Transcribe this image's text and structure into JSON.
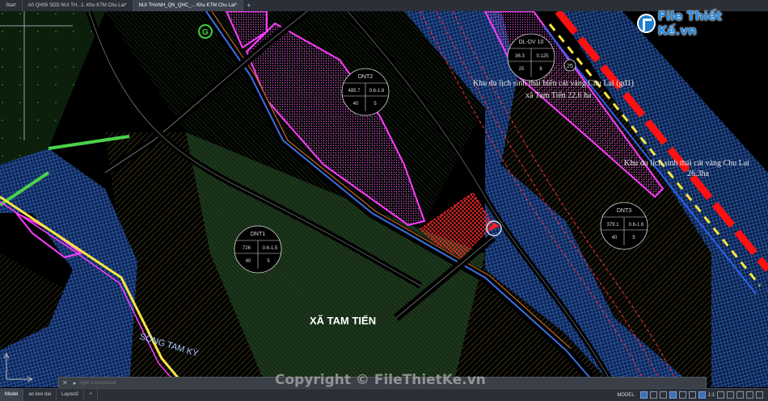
{
  "tabs": [
    {
      "label": "Start"
    },
    {
      "label": "A0 QH05 SDD NUI TH...1. Khu KTM Chu Lai*"
    },
    {
      "label": "NUI THANH_QN_QHC_... Khu KTM Chu Lai*"
    }
  ],
  "tab_plus": "+",
  "layout_tabs": [
    "Model",
    "ao keo dai",
    "Layout2"
  ],
  "command": {
    "placeholder": "Type a command",
    "prompt": "▸"
  },
  "status": {
    "model_label": "MODEL",
    "scale": "1:1"
  },
  "watermark": "Copyright © FileThietKe.vn",
  "logo": {
    "text": "File Thiết Kế",
    "domain": ".vn"
  },
  "map": {
    "commune_label": "XÃ TAM TIẾN",
    "river_label": "SÔNG TAM KỲ",
    "zone_label_1": "Khu du lịch sinh thái biển cát vàng Chu Lai (gđ1)",
    "zone_label_1b": "xã Tam Tiến 22.6 ha",
    "zone_label_2": "Khu du lịch sinh thái cát vàng Chu Lai",
    "zone_label_2b": "26.3ha",
    "marker_25": "25",
    "parcels": [
      {
        "name": "DNT2",
        "area": "485.7",
        "ratio": "0.6-1.6",
        "a": "40",
        "b": "5"
      },
      {
        "name": "DNT1",
        "area": "726",
        "ratio": "0.6-1.5",
        "a": "40",
        "b": "5"
      },
      {
        "name": "DNT3",
        "area": "379.1",
        "ratio": "0.6-1.6",
        "a": "40",
        "b": "5"
      },
      {
        "name": "DL-DV 10",
        "area": "36.3",
        "ratio": "0.125",
        "a": "25",
        "b": "8"
      }
    ]
  },
  "colors": {
    "canvas": "#000000",
    "green_zone": "#1a3a1a",
    "road": "#000000",
    "magenta": "#ff3dff",
    "river": "#1f3d7a",
    "red_block": "#ff2020"
  }
}
